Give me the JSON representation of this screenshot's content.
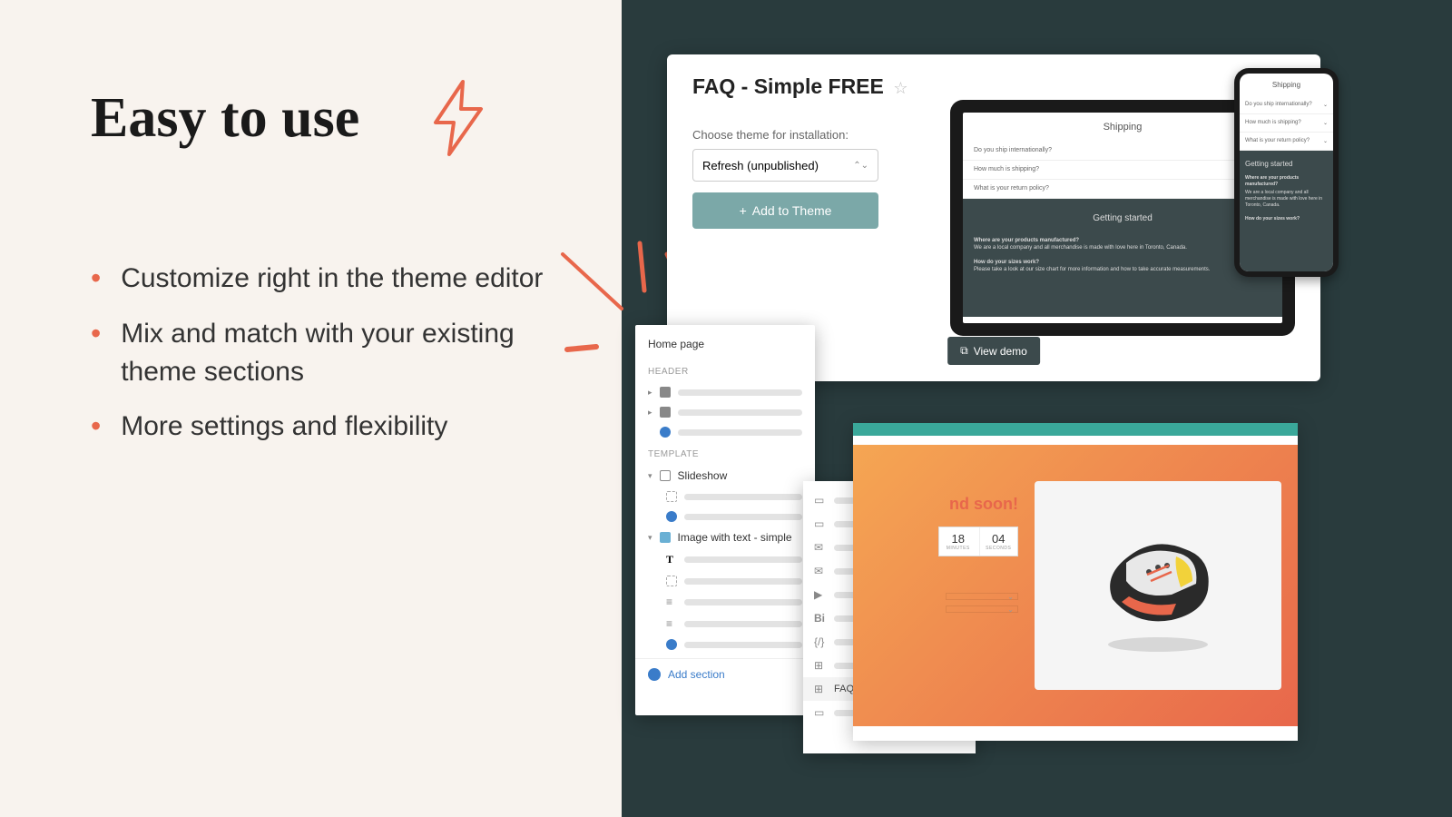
{
  "left": {
    "heading": "Easy to use",
    "bullets": [
      "Customize right in the theme editor",
      "Mix and match with your existing theme sections",
      "More settings and flexibility"
    ]
  },
  "install_card": {
    "title": "FAQ - Simple FREE",
    "choose_label": "Choose theme for installation:",
    "selected_theme": "Refresh (unpublished)",
    "add_button": "Add to Theme",
    "view_demo": "View demo"
  },
  "faq_preview": {
    "heading": "Shipping",
    "items": [
      "Do you ship internationally?",
      "How much is shipping?",
      "What is your return policy?"
    ],
    "dark_heading": "Getting started",
    "qa": [
      {
        "q": "Where are your products manufactured?",
        "a": "We are a local company and all merchandise is made with love here in Toronto, Canada."
      },
      {
        "q": "How do your sizes work?",
        "a": "Please take a look at our size chart for more information and how to take accurate measurements."
      }
    ]
  },
  "editor": {
    "title": "Home page",
    "sections": {
      "header_label": "HEADER",
      "template_label": "TEMPLATE",
      "slideshow": "Slideshow",
      "image_text": "Image with text - simple",
      "add_section": "Add section"
    }
  },
  "editor2": {
    "faq_label": "FAQ - simple FREE"
  },
  "site": {
    "headline": "nd soon!",
    "timer": [
      {
        "num": "18",
        "label": "MINUTES"
      },
      {
        "num": "04",
        "label": "SECONDS"
      }
    ]
  }
}
